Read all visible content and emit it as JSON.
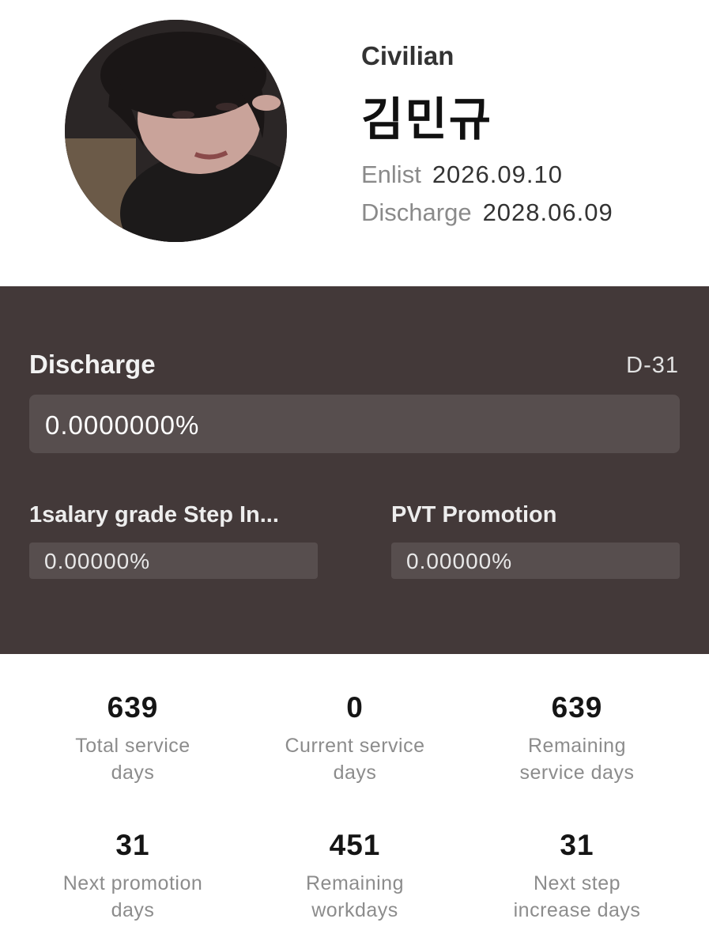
{
  "profile": {
    "role": "Civilian",
    "name": "김민규",
    "enlist_label": "Enlist",
    "enlist_date": "2026.09.10",
    "discharge_label": "Discharge",
    "discharge_date": "2028.06.09"
  },
  "progress": {
    "title": "Discharge",
    "dday": "D-31",
    "discharge_percent_text": "0.0000000%",
    "discharge_percent": 0,
    "step_title": "1salary grade Step In...",
    "step_percent_text": "0.00000%",
    "step_percent": 0,
    "promotion_title": "PVT Promotion",
    "promotion_percent_text": "0.00000%",
    "promotion_percent": 0
  },
  "stats": [
    {
      "value": "639",
      "caption_line1": "Total service",
      "caption_line2": "days"
    },
    {
      "value": "0",
      "caption_line1": "Current service",
      "caption_line2": "days"
    },
    {
      "value": "639",
      "caption_line1": "Remaining",
      "caption_line2": "service days"
    },
    {
      "value": "31",
      "caption_line1": "Next promotion",
      "caption_line2": "days"
    },
    {
      "value": "451",
      "caption_line1": "Remaining",
      "caption_line2": "workdays"
    },
    {
      "value": "31",
      "caption_line1": "Next step",
      "caption_line2": "increase days"
    }
  ],
  "colors": {
    "panel_bg": "#433939",
    "bar_bg": "#574e4e",
    "caption_gray": "#8c8c8c"
  },
  "icons": {
    "avatar": "profile-photo"
  }
}
